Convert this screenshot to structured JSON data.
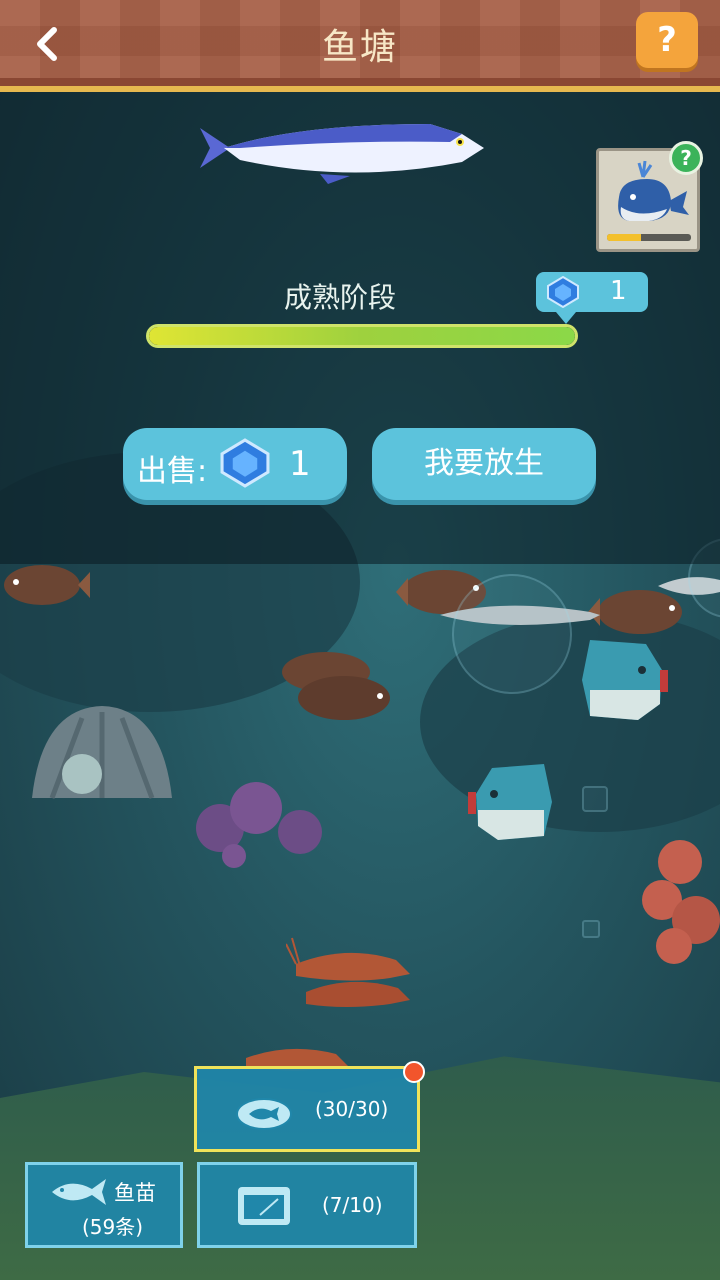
{
  "header": {
    "title": "鱼塘",
    "back_icon": "chevron-left-icon",
    "help_label": "?"
  },
  "fish_panel": {
    "stage_label": "成熟阶段",
    "growth_progress": 1.0,
    "reward_value": "1",
    "sell": {
      "label": "出售:",
      "value": "1"
    },
    "release_label": "我要放生"
  },
  "species_card": {
    "icon": "whale-icon",
    "badge": "?",
    "progress": 0.4
  },
  "bottom": {
    "feed": {
      "count": "(30/30)",
      "icon": "fish-food-icon"
    },
    "fry": {
      "label": "鱼苗",
      "count": "(59条)",
      "icon": "fish-icon"
    },
    "tank": {
      "count": "(7/10)",
      "icon": "tank-icon"
    }
  },
  "colors": {
    "header_bg": "#a65e45",
    "accent_gold": "#e6b84f",
    "button_blue": "#5cc3dc",
    "progress_green": "#8bd848",
    "help_orange": "#f4a43c",
    "notify_red": "#f2552c"
  }
}
